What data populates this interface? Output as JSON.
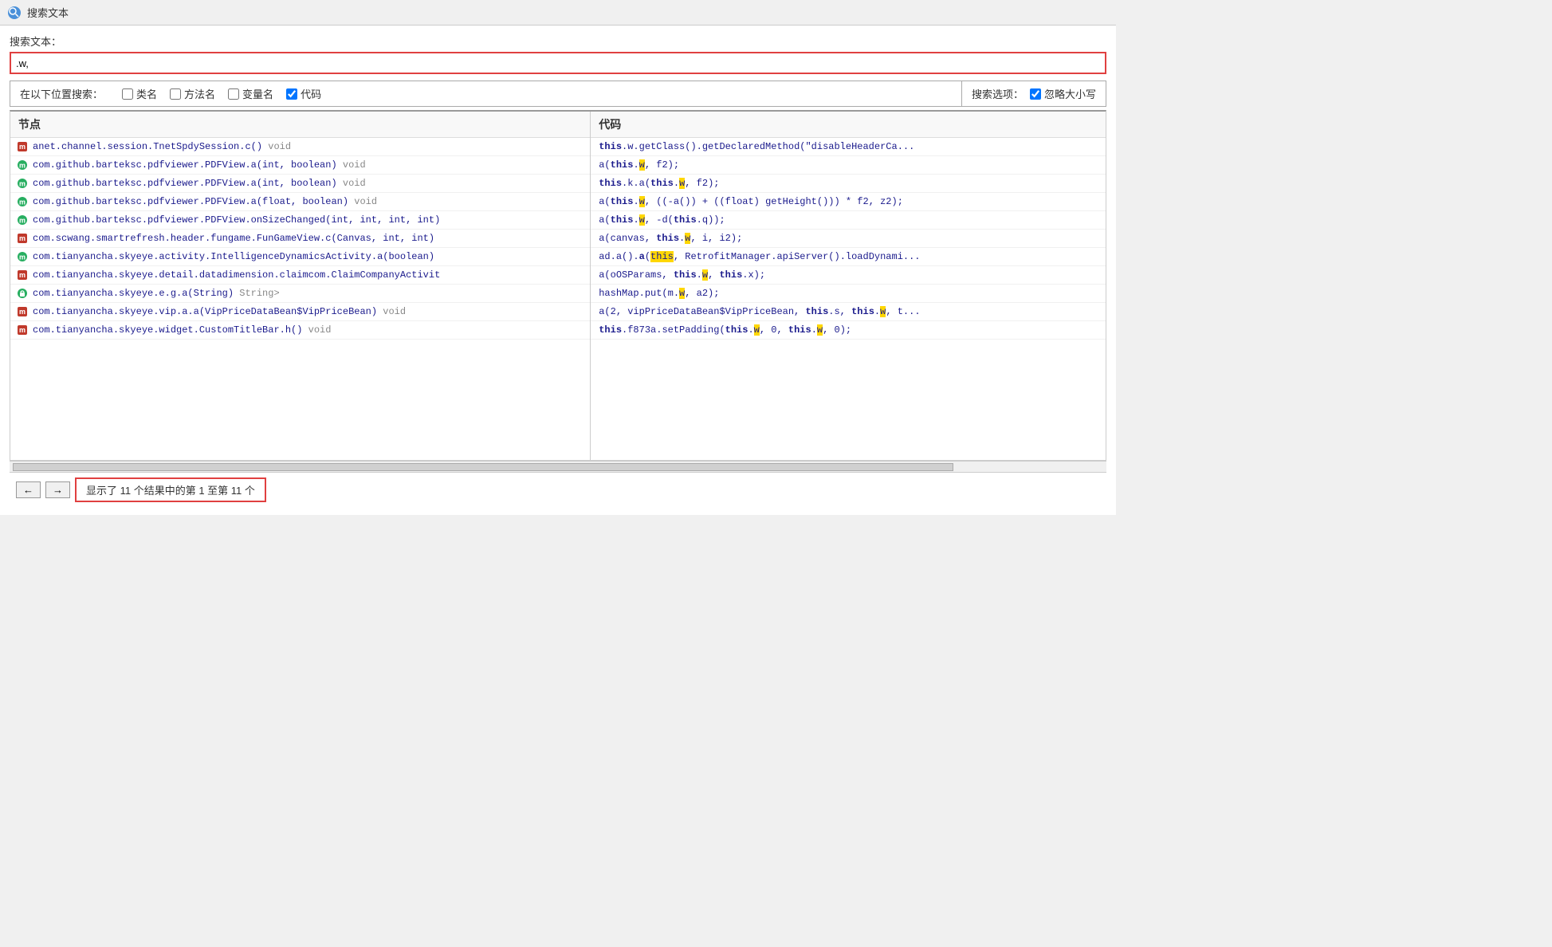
{
  "title": {
    "icon_label": "S",
    "text": "搜索文本"
  },
  "search": {
    "label": "搜索文本：",
    "input_value": ".w,",
    "input_placeholder": ""
  },
  "search_in": {
    "label": "在以下位置搜索：",
    "options": [
      {
        "id": "cb-class",
        "label": "类名",
        "checked": false
      },
      {
        "id": "cb-method",
        "label": "方法名",
        "checked": false
      },
      {
        "id": "cb-var",
        "label": "变量名",
        "checked": false
      },
      {
        "id": "cb-code",
        "label": "代码",
        "checked": true
      }
    ]
  },
  "search_options": {
    "label": "搜索选项：",
    "options": [
      {
        "id": "cb-case",
        "label": "忽略大小写",
        "checked": true
      }
    ]
  },
  "panels": {
    "nodes_header": "节点",
    "code_header": "代码"
  },
  "nodes": [
    {
      "icon": "red",
      "text": "anet.channel.session.TnetSpdySession.c() ",
      "suffix": "void"
    },
    {
      "icon": "green",
      "text": "com.github.barteksc.pdfviewer.PDFView.a(int, boolean) ",
      "suffix": "void"
    },
    {
      "icon": "green",
      "text": "com.github.barteksc.pdfviewer.PDFView.a(int, boolean) ",
      "suffix": "void"
    },
    {
      "icon": "green",
      "text": "com.github.barteksc.pdfviewer.PDFView.a(float, boolean) ",
      "suffix": "void"
    },
    {
      "icon": "green",
      "text": "com.github.barteksc.pdfviewer.PDFView.onSizeChanged(int, int, int, int)",
      "suffix": ""
    },
    {
      "icon": "red",
      "text": "com.scwang.smartrefresh.header.fungame.FunGameView.c(Canvas, int, int)",
      "suffix": ""
    },
    {
      "icon": "green",
      "text": "com.tianyancha.skyeye.activity.IntelligenceDynamicsActivity.a(boolean)",
      "suffix": ""
    },
    {
      "icon": "red",
      "text": "com.tianyancha.skyeye.detail.datadimension.claimcom.ClaimCompanyActivit",
      "suffix": ""
    },
    {
      "icon": "lock",
      "text": "com.tianyancha.skyeye.e.g.a(String) ",
      "suffix": "String>"
    },
    {
      "icon": "red",
      "text": "com.tianyancha.skyeye.vip.a.a(VipPriceDataBean$VipPriceBean) ",
      "suffix": "void"
    },
    {
      "icon": "red",
      "text": "com.tianyancha.skyeye.widget.CustomTitleBar.h() ",
      "suffix": "void"
    }
  ],
  "code_lines": [
    {
      "html": "<span class='kw'>this</span>.w.getClass().getDeclaredMethod(\"disableHeaderCa..."
    },
    {
      "html": "a(<span class='kw'>this</span>.<span class='hl'>w</span>, f2);"
    },
    {
      "html": "<span class='kw'>this</span>.k.a(<span class='kw'>this</span>.<span class='hl'>w</span>, f2);"
    },
    {
      "html": "a(<span class='kw'>this</span>.<span class='hl'>w</span>, ((-a()) + ((float) getHeight())) * f2, z2);"
    },
    {
      "html": "a(<span class='kw'>this</span>.<span class='hl'>w</span>, -d(<span class='kw'>this</span>.q));"
    },
    {
      "html": "a(canvas, <span class='kw'>this</span>.<span class='hl'>w</span>, i, i2);"
    },
    {
      "html": "ad.a().<span class='kw'>a</span>(<span class='hl'>this</span>, RetrofitManager.apiServer().loadDynami..."
    },
    {
      "html": "a(oOSParams, <span class='kw'>this</span>.<span class='hl'>w</span>, <span class='kw'>this</span>.x);"
    },
    {
      "html": "hashMap.put(m.<span class='hl'>w</span>, a2);"
    },
    {
      "html": "a(2, vipPriceDataBean$VipPriceBean, <span class='kw'>this</span>.s, <span class='kw'>this</span>.<span class='hl'>w</span>, t..."
    },
    {
      "html": "<span class='kw'>this</span>.f873a.setPadding(<span class='kw'>this</span>.<span class='hl'>w</span>, 0, <span class='kw'>this</span>.<span class='hl'>w</span>, 0);"
    }
  ],
  "bottom": {
    "prev_label": "←",
    "next_label": "→",
    "status_text": "显示了 11 个结果中的第 1 至第 11 个"
  }
}
